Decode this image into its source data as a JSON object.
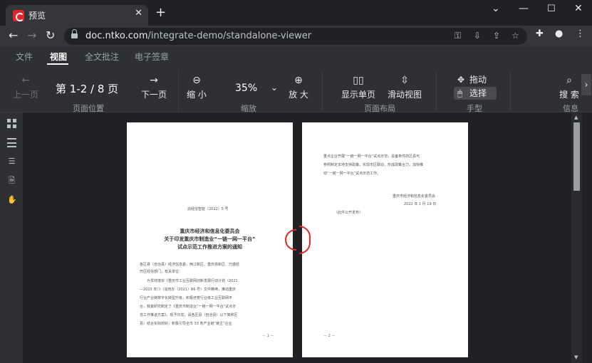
{
  "browser": {
    "tab_title": "预览",
    "url_host": "doc.ntko.com",
    "url_path": "/integrate-demo/standalone-viewer"
  },
  "menu": {
    "items": [
      "文件",
      "视图",
      "全文批注",
      "电子签章"
    ],
    "active": "视图"
  },
  "ribbon": {
    "prev_page": "上一页",
    "page_indicator": "第 1-2 / 8 页",
    "next_page": "下一页",
    "group_page_position": "页面位置",
    "zoom_out": "缩 小",
    "zoom_value": "35%",
    "zoom_in": "放 大",
    "group_zoom": "缩放",
    "single_page": "显示单页",
    "scroll_view": "滑动视图",
    "group_layout": "页面布局",
    "drag": "拖动",
    "select": "选择",
    "group_hand": "手型",
    "search": "搜 索",
    "group_info": "信息"
  },
  "page1": {
    "doc_number": "渝经信智能〔2022〕5 号",
    "title_lines": [
      "重庆市经济和信息化委员会",
      "关于印发重庆市制造业“一链一网一平台”",
      "试点示范工作推进方案的通知"
    ],
    "body_lines": [
      "各区县（自治县）经济信息委，两江新区、重庆高新区、万盛经",
      "开区经信部门，有关单位：",
      "　　为贯彻落实《重庆市工业互联网创新发展行动计划（2021",
      "—2023 年）》（渝府办〔2021〕86 号）文件精神，推动重庆",
      "行业产业链数字化转型升级，积极培育行业级工业互联网平",
      "台，我委研究制定了《重庆市制造业“一链一网一平台”试点示",
      "范工作推进方案》，现予印发，请各区县（自治县）以下简称区",
      "县）结合实际抓好，积极引导全市 33 条产业链“链主”企业"
    ],
    "page_num": "－ 1 －"
  },
  "page2": {
    "body_lines": [
      "重点企业开展“一链一网一平台”试点示范，具备条件的区县可",
      "参照制定本地支持政策，实现市区联动，形成政策合力，加快推",
      "动“一链一网一平台”试点示范工作。"
    ],
    "signature": "重庆市经济和信息化委员会",
    "date": "2022 年 1 月 19 日",
    "note": "（此件公开发布）",
    "page_num": "－ 2 －"
  }
}
